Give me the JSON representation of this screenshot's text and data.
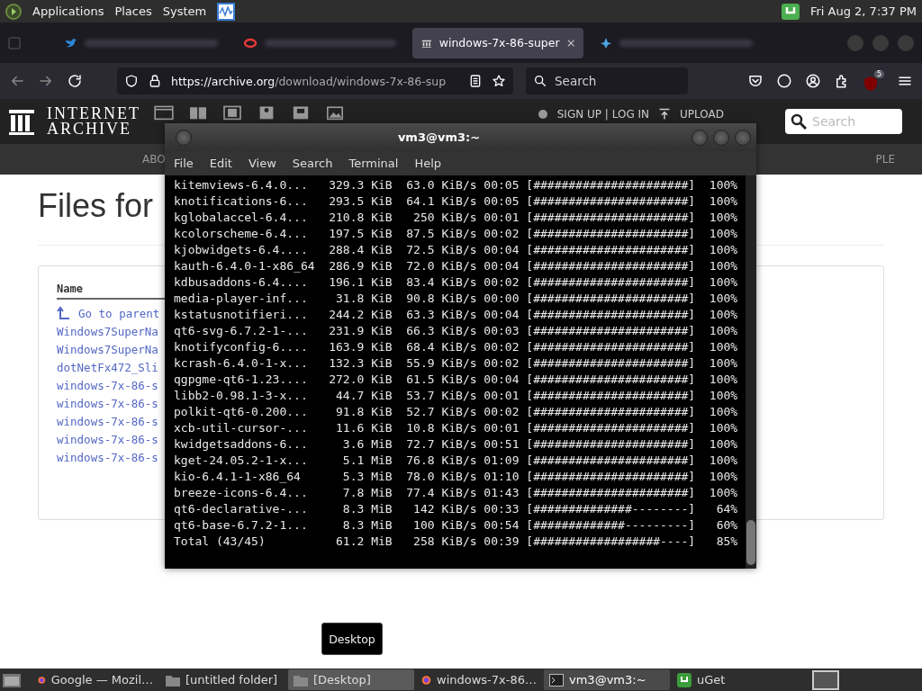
{
  "top_panel": {
    "menus": [
      "Applications",
      "Places",
      "System"
    ],
    "clock": "Fri Aug 2, 7:37 PM"
  },
  "browser": {
    "tabs": [
      {
        "kind": "bird",
        "selected": false
      },
      {
        "kind": "ring",
        "selected": false
      },
      {
        "kind": "archive",
        "title": "windows-7x-86-super",
        "selected": true
      },
      {
        "kind": "star",
        "selected": false
      }
    ],
    "url": {
      "host": "https://archive.org",
      "path": "/download/windows-7x-86-sup"
    },
    "search": {
      "placeholder": "Search"
    },
    "extension_badge": "5"
  },
  "site_header": {
    "logo": [
      "INTERNET",
      "ARCHIVE"
    ],
    "account": "SIGN UP | LOG IN",
    "upload": "UPLOAD",
    "search": {
      "placeholder": "Search"
    },
    "subnav": [
      "ABO",
      "PLE"
    ]
  },
  "page": {
    "heading": "Files for",
    "name_header": "Name",
    "parent_link": "Go to parent",
    "files": [
      "Windows7SuperNa",
      "Windows7SuperNa",
      "dotNetFx472_Sli",
      "windows-7x-86-s",
      "windows-7x-86-s",
      "windows-7x-86-s",
      "windows-7x-86-s",
      "windows-7x-86-s"
    ]
  },
  "terminal": {
    "title": "vm3@vm3:~",
    "menu": [
      "File",
      "Edit",
      "View",
      "Search",
      "Terminal",
      "Help"
    ],
    "rows": [
      {
        "name": "kitemviews-6.4.0...",
        "size": "329.3 KiB",
        "rate": "63.0 KiB/s",
        "eta": "00:05",
        "bar": "[######################]",
        "pct": "100%"
      },
      {
        "name": "knotifications-6...",
        "size": "293.5 KiB",
        "rate": "64.1 KiB/s",
        "eta": "00:05",
        "bar": "[######################]",
        "pct": "100%"
      },
      {
        "name": "kglobalaccel-6.4...",
        "size": "210.8 KiB",
        "rate": "250 KiB/s",
        "eta": "00:01",
        "bar": "[######################]",
        "pct": "100%"
      },
      {
        "name": "kcolorscheme-6.4...",
        "size": "197.5 KiB",
        "rate": "87.5 KiB/s",
        "eta": "00:02",
        "bar": "[######################]",
        "pct": "100%"
      },
      {
        "name": "kjobwidgets-6.4....",
        "size": "288.4 KiB",
        "rate": "72.5 KiB/s",
        "eta": "00:04",
        "bar": "[######################]",
        "pct": "100%"
      },
      {
        "name": "kauth-6.4.0-1-x86_64",
        "size": "286.9 KiB",
        "rate": "72.0 KiB/s",
        "eta": "00:04",
        "bar": "[######################]",
        "pct": "100%"
      },
      {
        "name": "kdbusaddons-6.4....",
        "size": "196.1 KiB",
        "rate": "83.4 KiB/s",
        "eta": "00:02",
        "bar": "[######################]",
        "pct": "100%"
      },
      {
        "name": "media-player-inf...",
        "size": "31.8 KiB",
        "rate": "90.8 KiB/s",
        "eta": "00:00",
        "bar": "[######################]",
        "pct": "100%"
      },
      {
        "name": "kstatusnotifieri...",
        "size": "244.2 KiB",
        "rate": "63.3 KiB/s",
        "eta": "00:04",
        "bar": "[######################]",
        "pct": "100%"
      },
      {
        "name": "qt6-svg-6.7.2-1-...",
        "size": "231.9 KiB",
        "rate": "66.3 KiB/s",
        "eta": "00:03",
        "bar": "[######################]",
        "pct": "100%"
      },
      {
        "name": "knotifyconfig-6....",
        "size": "163.9 KiB",
        "rate": "68.4 KiB/s",
        "eta": "00:02",
        "bar": "[######################]",
        "pct": "100%"
      },
      {
        "name": "kcrash-6.4.0-1-x...",
        "size": "132.3 KiB",
        "rate": "55.9 KiB/s",
        "eta": "00:02",
        "bar": "[######################]",
        "pct": "100%"
      },
      {
        "name": "qgpgme-qt6-1.23....",
        "size": "272.0 KiB",
        "rate": "61.5 KiB/s",
        "eta": "00:04",
        "bar": "[######################]",
        "pct": "100%"
      },
      {
        "name": "libb2-0.98.1-3-x...",
        "size": "44.7 KiB",
        "rate": "53.7 KiB/s",
        "eta": "00:01",
        "bar": "[######################]",
        "pct": "100%"
      },
      {
        "name": "polkit-qt6-0.200...",
        "size": "91.8 KiB",
        "rate": "52.7 KiB/s",
        "eta": "00:02",
        "bar": "[######################]",
        "pct": "100%"
      },
      {
        "name": "xcb-util-cursor-...",
        "size": "11.6 KiB",
        "rate": "10.8 KiB/s",
        "eta": "00:01",
        "bar": "[######################]",
        "pct": "100%"
      },
      {
        "name": "kwidgetsaddons-6...",
        "size": "3.6 MiB",
        "rate": "72.7 KiB/s",
        "eta": "00:51",
        "bar": "[######################]",
        "pct": "100%"
      },
      {
        "name": "kget-24.05.2-1-x...",
        "size": "5.1 MiB",
        "rate": "76.8 KiB/s",
        "eta": "01:09",
        "bar": "[######################]",
        "pct": "100%"
      },
      {
        "name": "kio-6.4.1-1-x86_64",
        "size": "5.3 MiB",
        "rate": "78.0 KiB/s",
        "eta": "01:10",
        "bar": "[######################]",
        "pct": "100%"
      },
      {
        "name": "breeze-icons-6.4...",
        "size": "7.8 MiB",
        "rate": "77.4 KiB/s",
        "eta": "01:43",
        "bar": "[######################]",
        "pct": "100%"
      },
      {
        "name": "qt6-declarative-...",
        "size": "8.3 MiB",
        "rate": "142 KiB/s",
        "eta": "00:33",
        "bar": "[##############--------]",
        "pct": "64%"
      },
      {
        "name": "qt6-base-6.7.2-1...",
        "size": "8.3 MiB",
        "rate": "100 KiB/s",
        "eta": "00:54",
        "bar": "[#############---------]",
        "pct": "60%"
      },
      {
        "name": "Total (43/45)",
        "size": "61.2 MiB",
        "rate": "258 KiB/s",
        "eta": "00:39",
        "bar": "[##################----]",
        "pct": "85%"
      }
    ]
  },
  "tooltip": "Desktop",
  "taskbar": [
    {
      "kind": "firefox",
      "label": "Google — Mozil…",
      "selected": false,
      "hovered": false
    },
    {
      "kind": "folder",
      "label": "[untitled folder]",
      "selected": false,
      "hovered": false
    },
    {
      "kind": "folder",
      "label": "[Desktop]",
      "selected": false,
      "hovered": true
    },
    {
      "kind": "firefox",
      "label": "windows-7x-86…",
      "selected": false,
      "hovered": false
    },
    {
      "kind": "terminal",
      "label": "vm3@vm3:~",
      "selected": true,
      "hovered": false
    },
    {
      "kind": "uget",
      "label": "uGet",
      "selected": false,
      "hovered": false
    }
  ]
}
